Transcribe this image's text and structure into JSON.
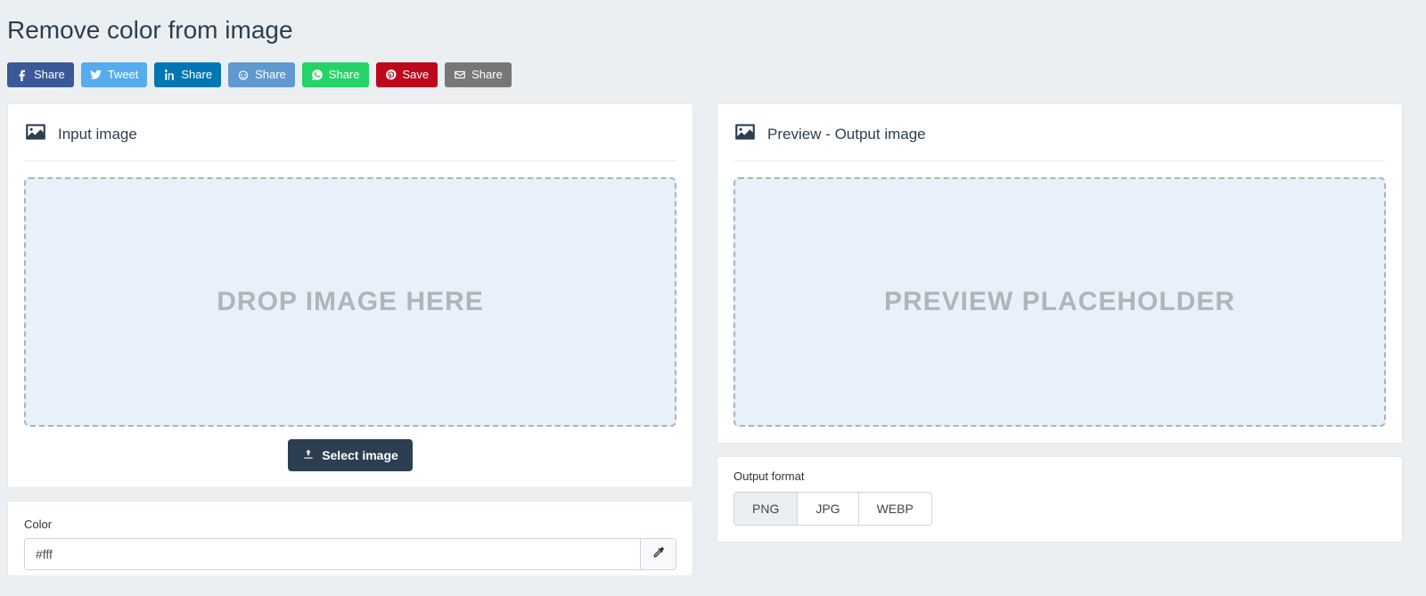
{
  "page_title": "Remove color from image",
  "share": {
    "facebook": "Share",
    "twitter": "Tweet",
    "linkedin": "Share",
    "reddit": "Share",
    "whatsapp": "Share",
    "pinterest": "Save",
    "email": "Share"
  },
  "input_panel": {
    "title": "Input image",
    "dropzone_text": "DROP IMAGE HERE",
    "select_button": "Select image"
  },
  "output_panel": {
    "title": "Preview - Output image",
    "placeholder_text": "PREVIEW PLACEHOLDER"
  },
  "color_panel": {
    "label": "Color",
    "value": "#fff"
  },
  "format_panel": {
    "label": "Output format",
    "options": [
      "PNG",
      "JPG",
      "WEBP"
    ],
    "active": "PNG"
  }
}
